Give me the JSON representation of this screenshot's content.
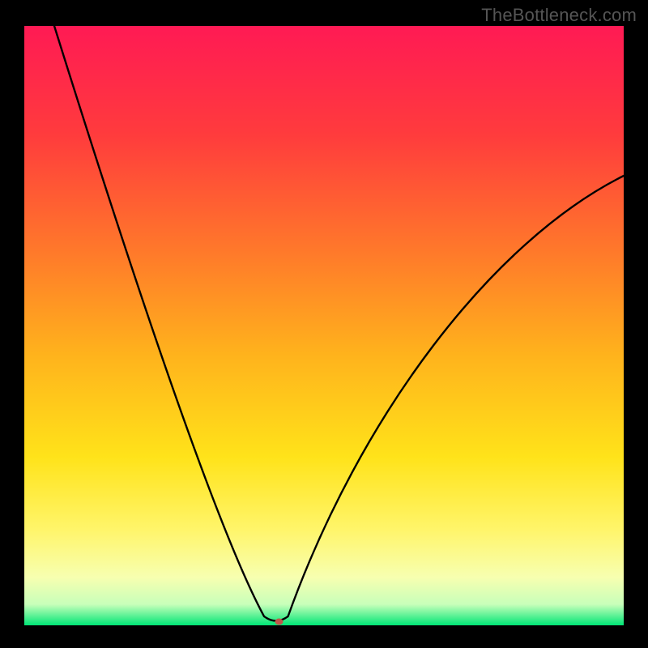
{
  "watermark": "TheBottleneck.com",
  "chart_data": {
    "type": "line",
    "title": "",
    "xlabel": "",
    "ylabel": "",
    "xlim": [
      0,
      100
    ],
    "ylim": [
      0,
      100
    ],
    "grid": false,
    "legend": false,
    "background_gradient": {
      "stops": [
        {
          "offset": 0.0,
          "color": "#ff1a54"
        },
        {
          "offset": 0.18,
          "color": "#ff3b3d"
        },
        {
          "offset": 0.38,
          "color": "#ff7a2a"
        },
        {
          "offset": 0.55,
          "color": "#ffb31c"
        },
        {
          "offset": 0.72,
          "color": "#ffe31a"
        },
        {
          "offset": 0.84,
          "color": "#fff56a"
        },
        {
          "offset": 0.92,
          "color": "#f7ffb0"
        },
        {
          "offset": 0.965,
          "color": "#c8ffba"
        },
        {
          "offset": 1.0,
          "color": "#00e676"
        }
      ]
    },
    "curve": {
      "left_top": {
        "x": 5,
        "y": 100
      },
      "valley": {
        "x": 42,
        "y": 0
      },
      "valley_width": 4,
      "right_end": {
        "x": 100,
        "y": 75
      },
      "left_control": {
        "x": 30,
        "y": 20
      },
      "right_control1": {
        "x": 56,
        "y": 35
      },
      "right_control2": {
        "x": 78,
        "y": 64
      }
    },
    "marker": {
      "x": 42.5,
      "y": 0.6,
      "rx": 5,
      "ry": 4,
      "color": "#c0564a"
    }
  }
}
